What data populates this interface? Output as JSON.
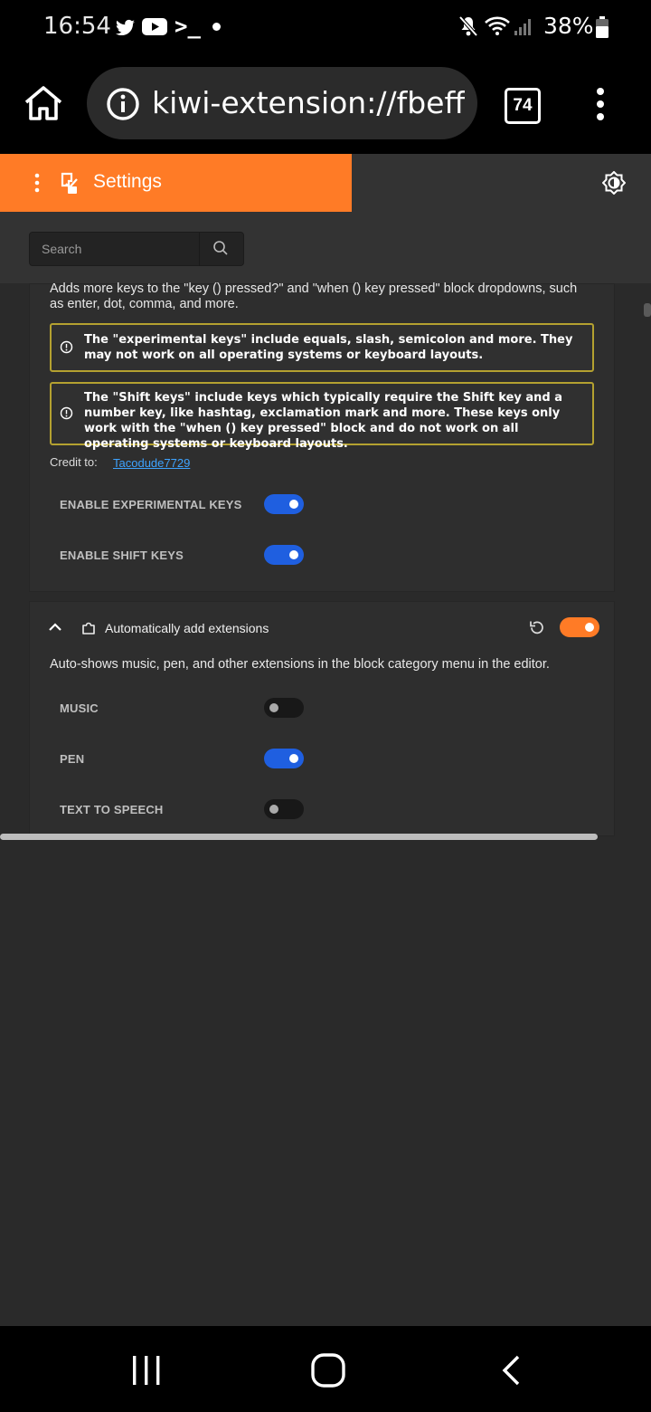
{
  "status_bar": {
    "time": "16:54",
    "battery": "38%"
  },
  "browser": {
    "url": "kiwi-extension://fbeffbjdlemaoicjdapfpikkikjoneco",
    "tab_count": "74"
  },
  "settings": {
    "title": "Settings",
    "search_placeholder": "Search"
  },
  "addon_keys": {
    "description": "Adds more keys to the \"key () pressed?\" and \"when () key pressed\" block dropdowns, such as enter, dot, comma, and more.",
    "notice_experimental": "The \"experimental keys\" include equals, slash, semicolon and more. They may not work on all operating systems or keyboard layouts.",
    "notice_shift": "The \"Shift keys\" include keys which typically require the Shift key and a number key, like hashtag, exclamation mark and more. These keys only work with the \"when () key pressed\" block and do not work on all operating systems or keyboard layouts.",
    "credit_label": "Credit to:",
    "credit_name": "Tacodude7729",
    "options": [
      {
        "label": "ENABLE EXPERIMENTAL KEYS",
        "enabled": true
      },
      {
        "label": "ENABLE SHIFT KEYS",
        "enabled": true
      }
    ]
  },
  "addon_extensions": {
    "title": "Automatically add extensions",
    "enabled": true,
    "description": "Auto-shows music, pen, and other extensions in the block category menu in the editor.",
    "options": [
      {
        "label": "MUSIC",
        "enabled": false
      },
      {
        "label": "PEN",
        "enabled": true
      },
      {
        "label": "TEXT TO SPEECH",
        "enabled": false
      }
    ]
  },
  "colors": {
    "accent": "#ff7b26",
    "toggle_on": "#1f5fe0",
    "notice_border": "#b4a130",
    "link": "#3ea3ff"
  }
}
